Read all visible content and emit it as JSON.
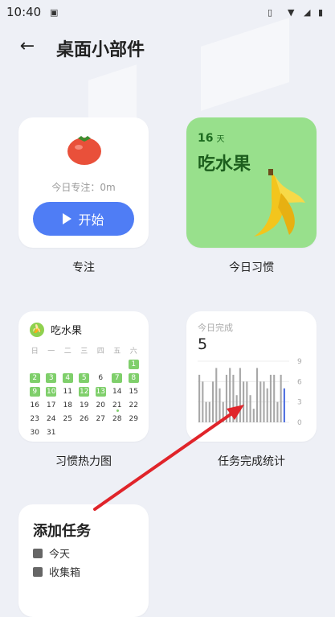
{
  "status": {
    "time": "10:40"
  },
  "header": {
    "title": "桌面小部件"
  },
  "widgets": {
    "focus": {
      "text": "今日专注：0m",
      "button": "开始",
      "label": "专注"
    },
    "habit": {
      "days": "16",
      "days_unit": "天",
      "name": "吃水果",
      "label": "今日习惯"
    },
    "heatmap": {
      "title": "吃水果",
      "label": "习惯热力图",
      "weekdays": [
        "日",
        "一",
        "二",
        "三",
        "四",
        "五",
        "六"
      ],
      "rows": [
        [
          "",
          "",
          "",
          "",
          "",
          "",
          "1"
        ],
        [
          "2",
          "3",
          "4",
          "5",
          "6",
          "7",
          "8"
        ],
        [
          "9",
          "10",
          "11",
          "12",
          "13",
          "14",
          "15"
        ],
        [
          "16",
          "17",
          "18",
          "19",
          "20",
          "21",
          "22"
        ],
        [
          "23",
          "24",
          "25",
          "26",
          "27",
          "28",
          "29"
        ],
        [
          "30",
          "31",
          "",
          "",
          "",
          "",
          ""
        ]
      ],
      "marked": [
        "1",
        "2",
        "3",
        "4",
        "5",
        "7",
        "8",
        "9",
        "10",
        "12",
        "13"
      ]
    },
    "stats": {
      "title": "今日完成",
      "value": "5",
      "label": "任务完成统计",
      "chart_data": {
        "type": "bar",
        "y_ticks": [
          "9",
          "6",
          "3",
          "0"
        ],
        "ylim": [
          0,
          9
        ],
        "values": [
          7,
          6,
          3,
          3,
          6,
          8,
          5,
          3,
          7,
          8,
          7,
          4,
          8,
          6,
          6,
          4,
          2,
          8,
          6,
          6,
          5,
          7,
          7,
          3,
          7,
          5
        ],
        "highlight_color": "#4f6fe0",
        "bar_color": "#a8a8a8"
      }
    },
    "add_task": {
      "title": "添加任务",
      "items": [
        "今天",
        "收集箱"
      ]
    }
  },
  "colors": {
    "accent": "#4f7df5",
    "habit_bg": "#98e08c",
    "arrow": "#e0242a"
  }
}
